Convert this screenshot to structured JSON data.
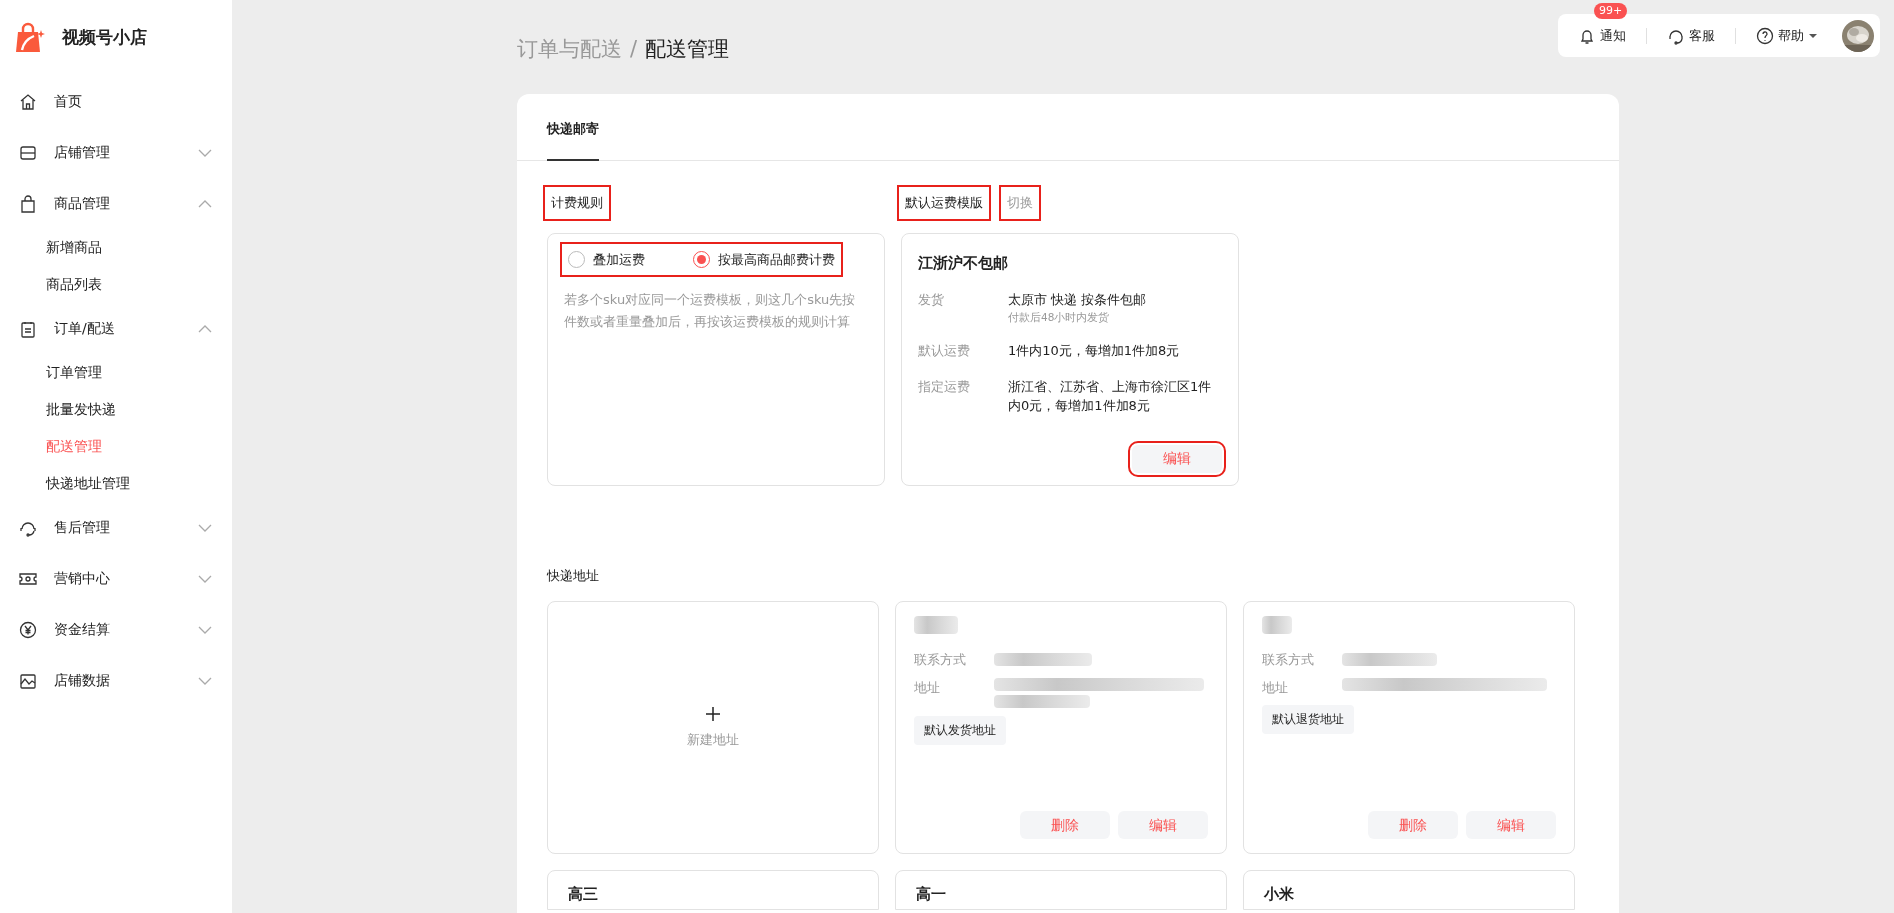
{
  "app": {
    "name": "视频号小店"
  },
  "sidebar": {
    "items": [
      {
        "label": "首页",
        "selected": false
      },
      {
        "label": "店铺管理",
        "selected": false,
        "expanded": false
      },
      {
        "label": "商品管理",
        "selected": false,
        "expanded": true,
        "children": [
          {
            "label": "新增商品",
            "selected": false
          },
          {
            "label": "商品列表",
            "selected": false
          }
        ]
      },
      {
        "label": "订单/配送",
        "selected": false,
        "expanded": true,
        "children": [
          {
            "label": "订单管理",
            "selected": false
          },
          {
            "label": "批量发快递",
            "selected": false
          },
          {
            "label": "配送管理",
            "selected": true
          },
          {
            "label": "快递地址管理",
            "selected": false
          }
        ]
      },
      {
        "label": "售后管理",
        "selected": false,
        "expanded": false
      },
      {
        "label": "营销中心",
        "selected": false,
        "expanded": false
      },
      {
        "label": "资金结算",
        "selected": false,
        "expanded": false
      },
      {
        "label": "店铺数据",
        "selected": false,
        "expanded": false
      }
    ]
  },
  "breadcrumb": {
    "parent": "订单与配送",
    "separator": "/",
    "current": "配送管理"
  },
  "header": {
    "notice": "通知",
    "badge": "99+",
    "service": "客服",
    "help": "帮助"
  },
  "tabs": [
    {
      "label": "快递邮寄",
      "selected": true
    }
  ],
  "billing": {
    "title": "计费规则",
    "title_highlighted": true,
    "options_highlighted": true,
    "options": [
      {
        "label": "叠加运费",
        "selected": false
      },
      {
        "label": "按最高商品邮费计费",
        "selected": true
      }
    ],
    "note": "若多个sku对应同一个运费模板，则这几个sku先按件数或者重量叠加后，再按该运费模板的规则计算"
  },
  "template": {
    "title": "默认运费模版",
    "title_highlighted": true,
    "switch": "切换",
    "switch_highlighted": true,
    "name": "江浙沪不包邮",
    "rows": [
      {
        "label": "发货",
        "value": "太原市 快递 按条件包邮",
        "sub": "付款后48小时内发货"
      },
      {
        "label": "默认运费",
        "value": "1件内10元，每增加1件加8元"
      },
      {
        "label": "指定运费",
        "value": "浙江省、江苏省、上海市徐汇区1件内0元，每增加1件加8元"
      }
    ],
    "edit": "编辑",
    "edit_highlighted": true
  },
  "addresses": {
    "title": "快递地址",
    "new_label": "新建地址",
    "cards": [
      {
        "contact_label": "联系方式",
        "address_label": "地址",
        "tag": "默认发货地址",
        "delete": "删除",
        "edit": "编辑"
      },
      {
        "contact_label": "联系方式",
        "address_label": "地址",
        "tag": "默认退货地址",
        "delete": "删除",
        "edit": "编辑"
      }
    ],
    "more_cards": [
      {
        "name": "高三"
      },
      {
        "name": "高一"
      },
      {
        "name": "小米"
      }
    ]
  }
}
